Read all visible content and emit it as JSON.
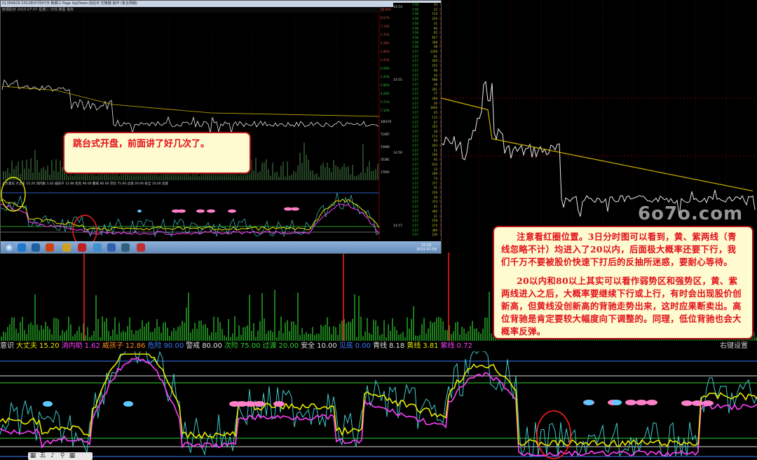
{
  "inset": {
    "title": "0] 000629 2013年07月07日 鞍钢三 Page Up/Down:前后日 空格键:操作 (复合周期)",
    "toolbar": "鞍钢股份   2015-07-07 星期二 均线 量图 指标",
    "price_axis": [
      "10.00%",
      "8.57%",
      "7.14%",
      "5.71%",
      "4.29%",
      "2.86%",
      "1.43%",
      "0.00%",
      "1.43%",
      "2.86%",
      "4.29%",
      "5.71%",
      "7.14%"
    ],
    "volume_axis": [
      "106176",
      "71687",
      "53069",
      "35381",
      "17693"
    ],
    "times": [
      "14:54",
      "14:55",
      "14:56",
      "14:57",
      "14:58"
    ],
    "ticks": [
      {
        "p": "3.58",
        "v": "34",
        "s": "S"
      },
      {
        "p": "3.58",
        "v": "22",
        "s": "B"
      },
      {
        "p": "3.58",
        "v": "110",
        "s": "S"
      },
      {
        "p": "3.58",
        "v": "234",
        "s": "B"
      },
      {
        "p": "3.58",
        "v": "31",
        "s": "S"
      },
      {
        "p": "3.58",
        "v": "80",
        "s": "S"
      },
      {
        "p": "3.58",
        "v": "65",
        "s": "B"
      },
      {
        "p": "3.58",
        "v": "627",
        "s": "S"
      },
      {
        "p": "3.58",
        "v": "308",
        "s": "S"
      },
      {
        "p": "3.58",
        "v": "48",
        "s": "B"
      },
      {
        "p": "3.57",
        "v": "1200",
        "s": "S"
      },
      {
        "p": "3.57",
        "v": "61",
        "s": "S"
      },
      {
        "p": "3.57",
        "v": "420",
        "s": "B"
      },
      {
        "p": "3.57",
        "v": "155",
        "s": "S"
      },
      {
        "p": "3.57",
        "v": "90",
        "s": "S"
      },
      {
        "p": "3.57",
        "v": "26",
        "s": "B"
      },
      {
        "p": "3.57",
        "v": "488",
        "s": "S"
      },
      {
        "p": "3.57",
        "v": "39",
        "s": "S"
      },
      {
        "p": "3.57",
        "v": "201",
        "s": "B"
      },
      {
        "p": "3.57",
        "v": "77",
        "s": "S"
      },
      {
        "p": "3.57",
        "v": "298",
        "s": "S"
      },
      {
        "p": "3.57",
        "v": "56",
        "s": "B"
      },
      {
        "p": "3.57",
        "v": "1830",
        "s": "S"
      },
      {
        "p": "3.57",
        "v": "45",
        "s": "S"
      },
      {
        "p": "3.57",
        "v": "112",
        "s": "B"
      },
      {
        "p": "3.57",
        "v": "67",
        "s": "S"
      },
      {
        "p": "3.57",
        "v": "355",
        "s": "S"
      },
      {
        "p": "3.57",
        "v": "28",
        "s": "B"
      },
      {
        "p": "3.57",
        "v": "172",
        "s": "S"
      },
      {
        "p": "3.57",
        "v": "84",
        "s": "S"
      },
      {
        "p": "3.57",
        "v": "403",
        "s": "B"
      },
      {
        "p": "3.57",
        "v": "51",
        "s": "S"
      },
      {
        "p": "3.57",
        "v": "246",
        "s": "S"
      },
      {
        "p": "3.57",
        "v": "92",
        "s": "B"
      },
      {
        "p": "3.57",
        "v": "610",
        "s": "S"
      },
      {
        "p": "3.57",
        "v": "33",
        "s": "S"
      },
      {
        "p": "3.57",
        "v": "189",
        "s": "B"
      },
      {
        "p": "3.57",
        "v": "74",
        "s": "S"
      },
      {
        "p": "3.57",
        "v": "377",
        "s": "S"
      },
      {
        "p": "3.57",
        "v": "41",
        "s": "B"
      },
      {
        "p": "3.57",
        "v": "226",
        "s": "S"
      },
      {
        "p": "3.57",
        "v": "58",
        "s": "S"
      },
      {
        "p": "3.57",
        "v": "374",
        "s": "B"
      },
      {
        "p": "3.57",
        "v": "65",
        "s": "S"
      },
      {
        "p": "3.57",
        "v": "400",
        "s": "S"
      },
      {
        "p": "3.57",
        "v": "31",
        "s": "B"
      },
      {
        "p": "3.57",
        "v": "158",
        "s": "S"
      },
      {
        "p": "3.57",
        "v": "274",
        "s": "S"
      },
      {
        "p": "3.57",
        "v": "389",
        "s": "B"
      },
      {
        "p": "3.57",
        "v": "120",
        "s": "S"
      }
    ],
    "legend": "大大意志 大丈夫 15.20 消内助 1.62 威孩子 12.86 危险 90.00 警戒 80.00 次险 75.00 过渡 20.00 安全 10.00 见底",
    "right_click": "右键设置",
    "taskbar_date": "2015-07-09",
    "taskbar_time": "22:25"
  },
  "callouts": {
    "first": "跳台式开盘，前面讲了好几次了。",
    "second_p1": "注意看红圈位置。3日分时图可以看到，黄、紫两线（青线忽略不计）均进入了20以内，后面极大概率还要下行，我们千万不要被股价快速下打后的反抽所迷惑，要耐心等待。",
    "second_p2": "20以内和80以上其实可以看作弱势区和强势区，黄、紫两线进入之后，大概率要继续下行或上行，有时会出现股价创新高，但黄线没创新高的背驰走势出来，这时应果断卖出。高位背驰是肯定要较大幅度向下调整的。同理，低位背驰也会大概率反弹。"
  },
  "watermark": "6o7o.com",
  "legend": {
    "items": [
      {
        "label": "意识",
        "value": "",
        "color": "#e0e0e0"
      },
      {
        "label": "大丈夫",
        "value": "15.20",
        "color": "#e8e800"
      },
      {
        "label": "消内助",
        "value": "1.62",
        "color": "#ff40ff"
      },
      {
        "label": "威孩子",
        "value": "12.86",
        "color": "#ff8c1a"
      },
      {
        "label": "危险",
        "value": "90.00",
        "color": "#3a7bff"
      },
      {
        "label": "警戒",
        "value": "80.00",
        "color": "#e0e0e0"
      },
      {
        "label": "次险",
        "value": "75.00",
        "color": "#30d030"
      },
      {
        "label": "过渡",
        "value": "20.00",
        "color": "#30d030"
      },
      {
        "label": "安全",
        "value": "10.00",
        "color": "#e0e0e0"
      },
      {
        "label": "见底",
        "value": "0.00",
        "color": "#3a7bff"
      },
      {
        "label": "青线",
        "value": "8.18",
        "color": "#e0e0e0"
      },
      {
        "label": "黄线",
        "value": "3.81",
        "color": "#e8e800"
      },
      {
        "label": "紫线",
        "value": "0.72",
        "color": "#ff40ff"
      }
    ],
    "right_click": "右键设置"
  },
  "bottom_toolbar": [
    "▦",
    "五",
    "♪",
    "⚲",
    "▦"
  ],
  "colors": {
    "price_line": "#e8e8e8",
    "avg_line": "#c8b000",
    "yellow": "#e8e800",
    "magenta": "#ff40ff",
    "cyan": "#40c8c8",
    "red": "#ff2020",
    "grid_red": "#7a0000",
    "blue": "#3a7bff",
    "green": "#30d030"
  }
}
